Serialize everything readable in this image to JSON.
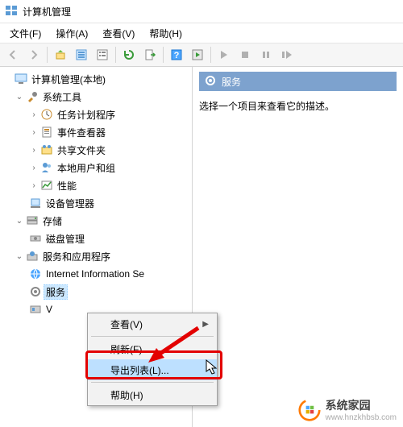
{
  "window": {
    "title": "计算机管理"
  },
  "menu": {
    "file": "文件(F)",
    "action": "操作(A)",
    "view": "查看(V)",
    "help": "帮助(H)"
  },
  "tree": {
    "root": "计算机管理(本地)",
    "tools": "系统工具",
    "sched": "任务计划程序",
    "event": "事件查看器",
    "share": "共享文件夹",
    "users": "本地用户和组",
    "perf": "性能",
    "devmgr": "设备管理器",
    "storage": "存储",
    "disk": "磁盘管理",
    "svcapp": "服务和应用程序",
    "iis": "Internet Information Se",
    "services": "服务",
    "wmi": "V"
  },
  "right": {
    "header": "服务",
    "desc": "选择一个项目来查看它的描述。"
  },
  "ctx": {
    "view": "查看(V)",
    "refresh": "刷新(F)",
    "export": "导出列表(L)...",
    "help": "帮助(H)"
  },
  "wm": {
    "name": "系统家园",
    "url": "www.hnzkhbsb.com"
  }
}
